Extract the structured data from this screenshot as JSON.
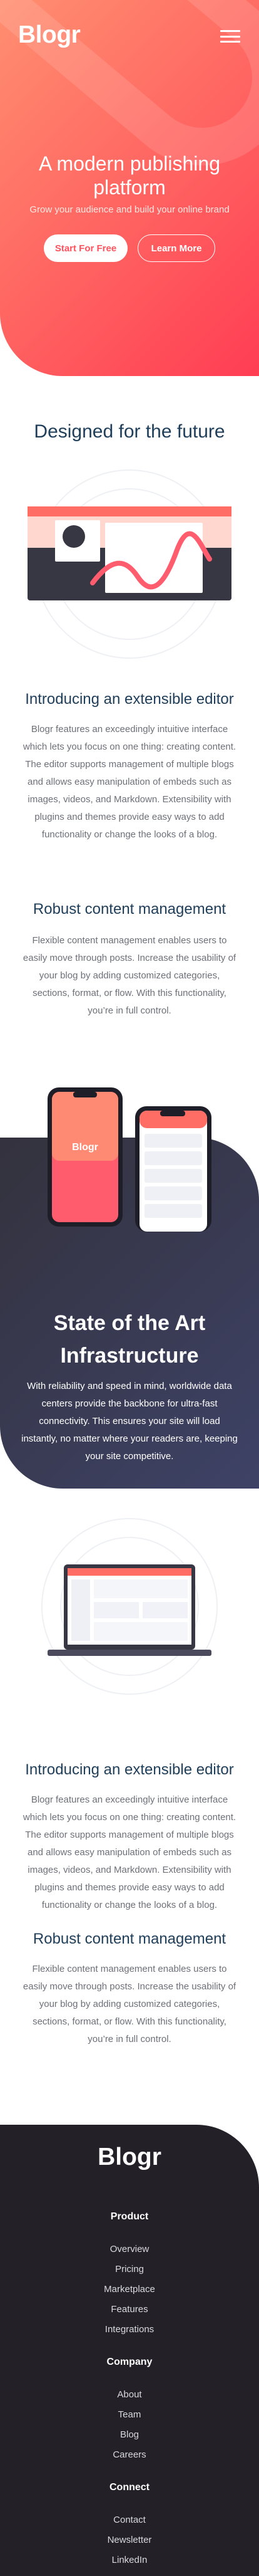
{
  "header": {
    "logo": "Blogr",
    "menu_icon": "hamburger-menu-icon"
  },
  "hero": {
    "title": "A modern publishing platform",
    "subtitle": "Grow your audience and build your online brand",
    "primary_button": "Start For Free",
    "secondary_button": "Learn More"
  },
  "design_section": {
    "title": "Designed for the future",
    "features": [
      {
        "title": "Introducing an extensible editor",
        "text": "Blogr features an exceedingly intuitive interface which lets you focus on one thing: creating content. The editor supports management of multiple blogs and allows easy manipulation of embeds such as images, videos, and Markdown. Extensibility with plugins and themes provide easy ways to add functionality or change the looks of a blog."
      },
      {
        "title": "Robust content management",
        "text": "Flexible content management enables users to easily move through posts. Increase the usability of your blog by adding customized categories, sections, format, or flow. With this functionality, you’re in full control."
      }
    ]
  },
  "phones": {
    "phone_logo": "Blogr"
  },
  "infrastructure": {
    "title": "State of the Art Infrastructure",
    "text": "With reliability and speed in mind, worldwide data centers provide the backbone for ultra-fast connectivity. This ensures your site will load instantly, no matter where your readers are, keeping your site competitive."
  },
  "laptop_section": {
    "features": [
      {
        "title": "Introducing an extensible editor",
        "text": "Blogr features an exceedingly intuitive interface which lets you focus on one thing: creating content. The editor supports management of multiple blogs and allows easy manipulation of embeds such as images, videos, and Markdown. Extensibility with plugins and themes provide easy ways to add functionality or change the looks of a blog."
      },
      {
        "title": "Robust content management",
        "text": "Flexible content management enables users to easily move through posts. Increase the usability of your blog by adding customized categories, sections, format, or flow. With this functionality, you’re in full control."
      }
    ]
  },
  "footer": {
    "logo": "Blogr",
    "groups": [
      {
        "heading": "Product",
        "links": [
          "Overview",
          "Pricing",
          "Marketplace",
          "Features",
          "Integrations"
        ]
      },
      {
        "heading": "Company",
        "links": [
          "About",
          "Team",
          "Blog",
          "Careers"
        ]
      },
      {
        "heading": "Connect",
        "links": [
          "Contact",
          "Newsletter",
          "LinkedIn"
        ]
      }
    ]
  },
  "colors": {
    "hero_gradient_start": "#ff8f70",
    "hero_gradient_end": "#ff3d54",
    "heading": "#1f3e5a",
    "body_text": "#6e7079",
    "dark_section": "#33323d",
    "footer_bg": "#232127"
  }
}
